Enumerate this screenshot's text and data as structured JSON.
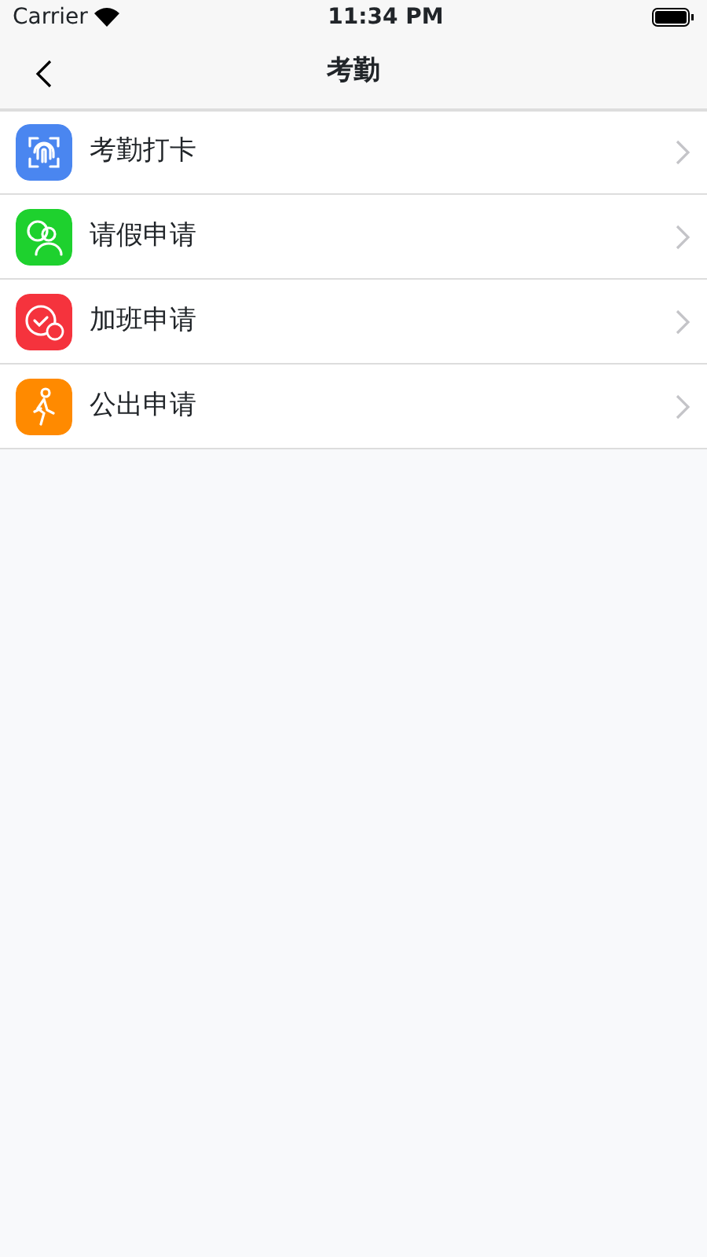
{
  "status_bar": {
    "carrier": "Carrier",
    "time": "11:34 PM"
  },
  "nav": {
    "title": "考勤"
  },
  "items": [
    {
      "label": "考勤打卡",
      "kind": "fingerprint",
      "color": "#4a86f0"
    },
    {
      "label": "请假申请",
      "kind": "people",
      "color": "#1ed12e"
    },
    {
      "label": "加班申请",
      "kind": "clock",
      "color": "#f5333d"
    },
    {
      "label": "公出申请",
      "kind": "walker",
      "color": "#ff8a00"
    }
  ]
}
